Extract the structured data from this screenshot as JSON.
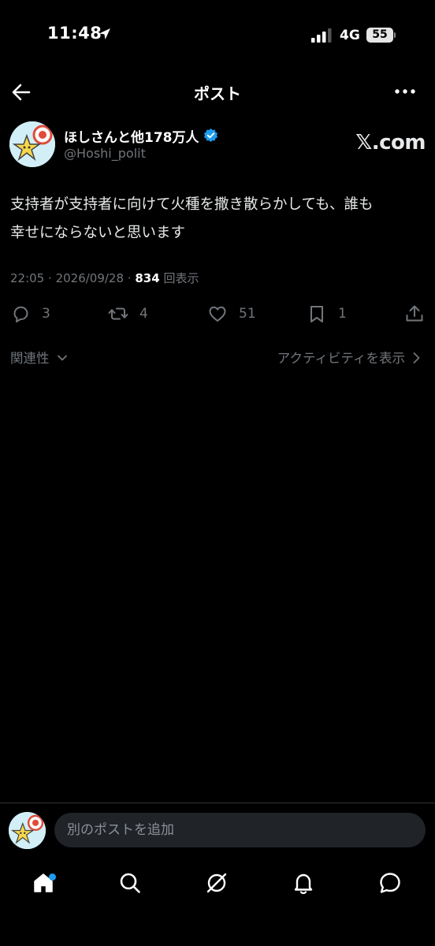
{
  "status_bar": {
    "time": "11:48",
    "network": "4G",
    "battery": "55"
  },
  "header": {
    "title": "ポスト"
  },
  "author": {
    "display_name": "ほしさんと他178万人",
    "handle": "@Hoshi_polit",
    "source": "𝕏.com"
  },
  "post": {
    "text_line1": "支持者が支持者に向けて火種を撒き散らかしても、誰も",
    "text_line2": "幸せにならないと思います",
    "time": "22:05",
    "date": "2026/09/28",
    "views": "834",
    "views_label": "回表示"
  },
  "actions": {
    "replies": "3",
    "reposts": "4",
    "likes": "51",
    "bookmarks": "1"
  },
  "replies_bar": {
    "sort_label": "関連性",
    "activity_link": "アクティビティを表示"
  },
  "compose": {
    "placeholder": "別のポストを追加"
  },
  "tab_bar": {
    "icons": [
      "home-icon",
      "search-icon",
      "grok-icon",
      "bell-icon",
      "messages-icon"
    ],
    "home_has_notification": true
  },
  "colors": {
    "background": "#000000",
    "accent": "#1d9bf0",
    "muted": "#71767b",
    "text": "#e7e9ea"
  }
}
